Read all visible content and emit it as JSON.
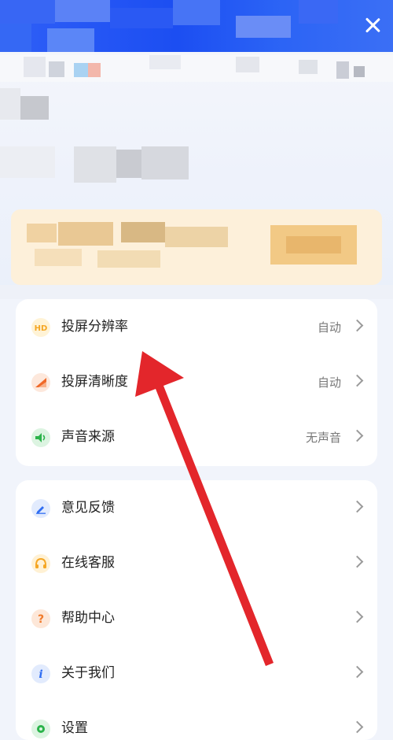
{
  "header": {
    "close_icon": "close-icon"
  },
  "settings_group_1": [
    {
      "label": "投屏分辨率",
      "value": "自动",
      "icon": "hd-icon",
      "color": "#f5a623"
    },
    {
      "label": "投屏清晰度",
      "value": "自动",
      "icon": "clarity-icon",
      "color": "#f06a2a"
    },
    {
      "label": "声音来源",
      "value": "无声音",
      "icon": "speaker-icon",
      "color": "#2bb34a"
    }
  ],
  "settings_group_2": [
    {
      "label": "意见反馈",
      "icon": "pencil-icon",
      "color": "#2f6df2"
    },
    {
      "label": "在线客服",
      "icon": "headset-icon",
      "color": "#f5a623"
    },
    {
      "label": "帮助中心",
      "icon": "question-icon",
      "color": "#f07a2a"
    },
    {
      "label": "关于我们",
      "icon": "info-icon",
      "color": "#2f6df2"
    },
    {
      "label": "设置",
      "icon": "settings-icon",
      "color": "#2bb34a"
    }
  ],
  "colors": {
    "header_blue": "#1c4ef2",
    "annotation_red": "#e3262b",
    "banner": "#fdf0da"
  }
}
